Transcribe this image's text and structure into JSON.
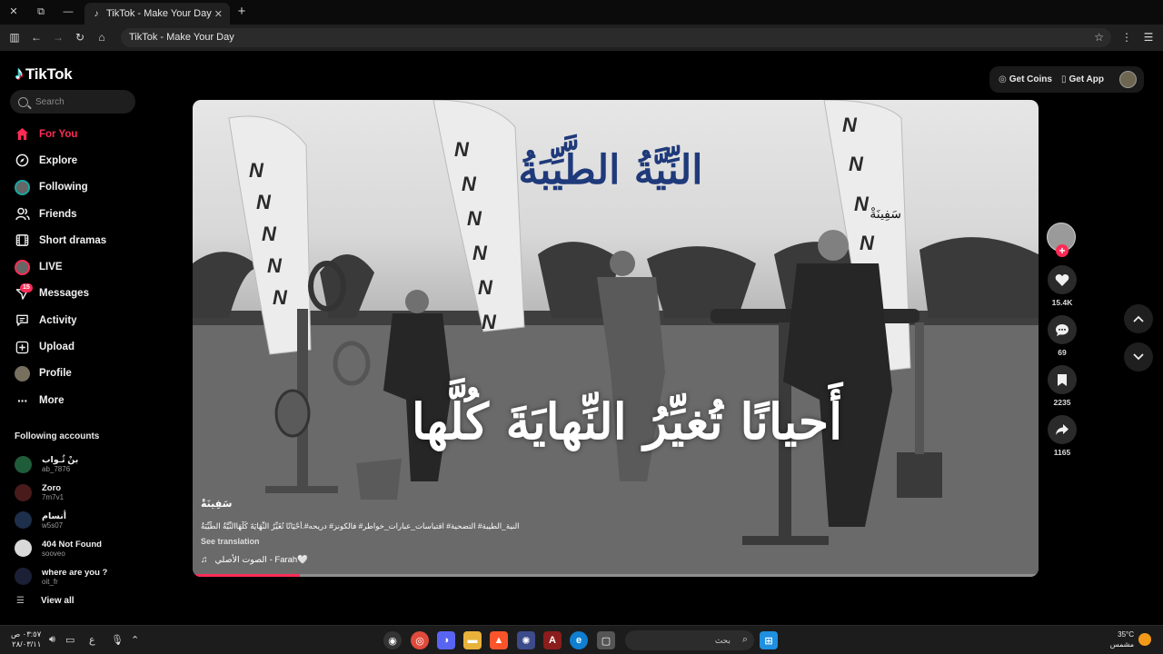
{
  "browser": {
    "tab_title": "TikTok - Make Your Day",
    "url": "TikTok - Make Your Day"
  },
  "sidebar": {
    "logo": "TikTok",
    "search_placeholder": "Search",
    "nav": [
      {
        "label": "For You",
        "icon": "home-icon",
        "active": true
      },
      {
        "label": "Explore",
        "icon": "compass-icon"
      },
      {
        "label": "Following",
        "icon": "following-avatar-icon"
      },
      {
        "label": "Friends",
        "icon": "friends-icon"
      },
      {
        "label": "Short dramas",
        "icon": "film-icon"
      },
      {
        "label": "LIVE",
        "icon": "live-icon"
      },
      {
        "label": "Messages",
        "icon": "messages-icon",
        "badge": "15"
      },
      {
        "label": "Activity",
        "icon": "activity-icon"
      },
      {
        "label": "Upload",
        "icon": "upload-icon"
      },
      {
        "label": "Profile",
        "icon": "profile-avatar-icon"
      },
      {
        "label": "More",
        "icon": "more-icon"
      }
    ],
    "following_title": "Following accounts",
    "accounts": [
      {
        "name": "بنْ ثُـواب",
        "handle": "ab_7876",
        "color": "#1f5c3a"
      },
      {
        "name": "Zoro",
        "handle": "7m7v1",
        "color": "#4a1b1b"
      },
      {
        "name": "أنسام",
        "handle": "w5s07",
        "color": "#1d2f4a"
      },
      {
        "name": "404 Not Found",
        "handle": "sooveo",
        "color": "#d9d9d9"
      },
      {
        "name": "where are you ?",
        "handle": "oit_fr",
        "color": "#1c2036"
      }
    ],
    "view_all": "View all"
  },
  "header": {
    "get_coins": "Get Coins",
    "get_app": "Get App"
  },
  "video": {
    "overlay_title": "النِّيَّةُ الطَّيِّبَةُ",
    "overlay_corner": "سَفِينَةْ",
    "overlay_caption": "أَحيانًا تُغيِّرُ النِّهايَةَ كُلَّها",
    "author": "سَفِينَةْ",
    "description": "النية_الطيبة# التضحية# اقتباسات_عبارات_خواطر# فالكونز# دريحه#.أَحْيَانًا تُغَيِّرُ النِّهَايَةَ كُلَّهَاالنِّيَّةُ الطَّيِّبَةُ",
    "see_translation": "See translation",
    "music": "الصوت الأصلي - Farah🤍",
    "progress": 0.127
  },
  "actions": {
    "likes": "15.4K",
    "comments": "69",
    "saves": "2235",
    "shares": "1165"
  },
  "taskbar": {
    "time": "٠٣:٥٧ ص",
    "date": "٢٨/٠٣/١١",
    "lang": "ع",
    "search_placeholder": "بحث",
    "weather_temp": "35°C",
    "weather_desc": "مشمس"
  },
  "colors": {
    "accent": "#fe2c55",
    "background": "#000000",
    "title_blue": "#1f3a7a"
  }
}
